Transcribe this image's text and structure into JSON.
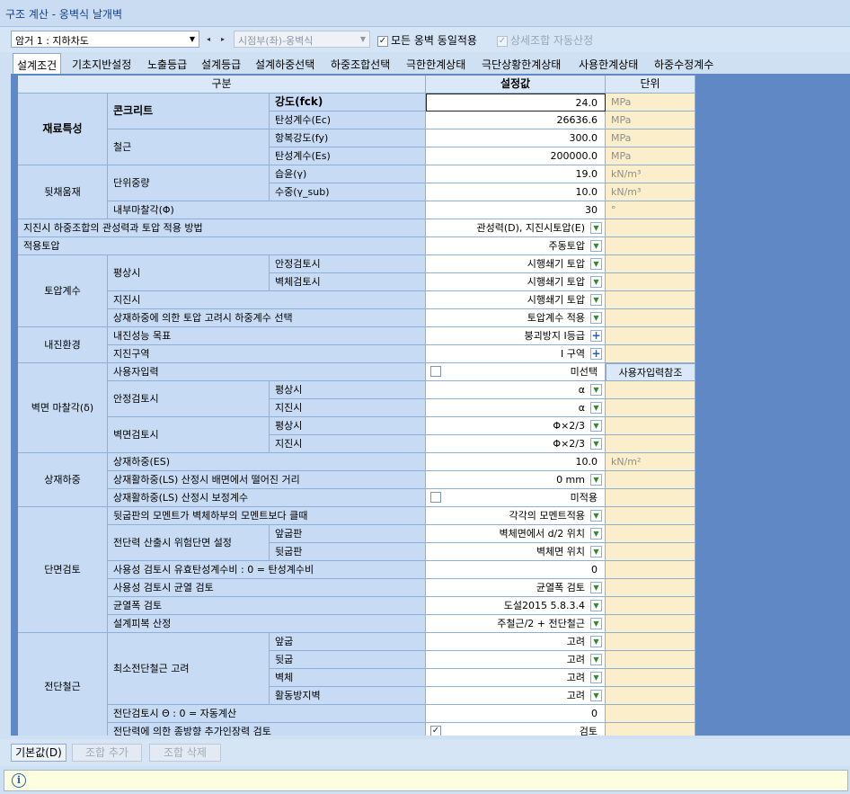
{
  "window": {
    "title": "구조 계산 - 옹벽식 날개벽"
  },
  "toolbar": {
    "section_combo": "암거 1 : 지하차도",
    "prev_icon": "◂",
    "next_icon": "▸",
    "position_combo": "시점부(좌)-옹벽식",
    "apply_all_label": "모든 옹벽 동일적용",
    "auto_combo_label": "상세조합 자동산정"
  },
  "tabs": [
    "설계조건",
    "기초지반설정",
    "노출등급",
    "설계등급",
    "설계하중선택",
    "하중조합선택",
    "극한한계상태",
    "극단상황한계상태",
    "사용한계상태",
    "하중수정계수"
  ],
  "grid": {
    "headers": {
      "category": "구분",
      "value": "설정값",
      "unit": "단위"
    },
    "material": {
      "cat": "재료특성",
      "concrete": "콘크리트",
      "rebar": "철근",
      "fck": {
        "label": "강도(fck)",
        "value": "24.0",
        "unit": "MPa"
      },
      "ec": {
        "label": "탄성계수(Ec)",
        "value": "26636.6",
        "unit": "MPa"
      },
      "fy": {
        "label": "항복강도(fy)",
        "value": "300.0",
        "unit": "MPa"
      },
      "es": {
        "label": "탄성계수(Es)",
        "value": "200000.0",
        "unit": "MPa"
      }
    },
    "backfill": {
      "cat": "뒷채움재",
      "unit_weight": "단위중량",
      "wet": {
        "label": "습윤(γ)",
        "value": "19.0",
        "unit": "kN/m³"
      },
      "sub": {
        "label": "수중(γ_sub)",
        "value": "10.0",
        "unit": "kN/m³"
      },
      "friction": {
        "label": "내부마찰각(Φ)",
        "value": "30",
        "unit": "°"
      }
    },
    "seismic_inertia": {
      "label": "지진시 하중조합의 관성력과 토압 적용 방법",
      "value": "관성력(D), 지진시토압(E)"
    },
    "applied_pressure": {
      "label": "적용토압",
      "value": "주동토압"
    },
    "pressure_coef": {
      "cat": "토압계수",
      "normal": "평상시",
      "stability": {
        "label": "안정검토시",
        "value": "시행쇄기 토압"
      },
      "wall": {
        "label": "벽체검토시",
        "value": "시행쇄기 토압"
      },
      "seismic": {
        "label": "지진시",
        "value": "시행쇄기 토압"
      },
      "surcharge": {
        "label": "상재하중에 의한 토압 고려시 하중계수 선택",
        "value": "토압계수 적용"
      }
    },
    "seismic_env": {
      "cat": "내진환경",
      "goal": {
        "label": "내진성능 목표",
        "value": "붕괴방지 I등급"
      },
      "zone": {
        "label": "지진구역",
        "value": "I 구역"
      }
    },
    "wall_friction": {
      "cat": "벽면 마찰각(δ)",
      "user": {
        "label": "사용자입력",
        "value": "미선택",
        "button": "사용자입력참조"
      },
      "stability": "안정검토시",
      "wall": "벽면검토시",
      "s_normal": {
        "label": "평상시",
        "value": "α"
      },
      "s_seismic": {
        "label": "지진시",
        "value": "α"
      },
      "w_normal": {
        "label": "평상시",
        "value": "Φ×2/3"
      },
      "w_seismic": {
        "label": "지진시",
        "value": "Φ×2/3"
      }
    },
    "surcharge": {
      "cat": "상재하중",
      "es": {
        "label": "상재하중(ES)",
        "value": "10.0",
        "unit": "kN/m²"
      },
      "ls_distance": {
        "label": "상재활하중(LS) 산정시 배면에서 떨어진 거리",
        "value": "0 mm"
      },
      "ls_factor": {
        "label": "상재활하중(LS) 산정시 보정계수",
        "value": "미적용"
      }
    },
    "section": {
      "cat": "단면검토",
      "heel_moment": {
        "label": "뒷굽판의 모멘트가 벽체하부의 모멘트보다 클때",
        "value": "각각의 모멘트적용"
      },
      "critical": "전단력 산출시 위험단면 설정",
      "toe": {
        "label": "앞굽판",
        "value": "벽체면에서 d/2 위치"
      },
      "heel": {
        "label": "뒷굽판",
        "value": "벽체면 위치"
      },
      "eff_ratio": {
        "label": "사용성 검토시 유효탄성계수비 : 0 = 탄성계수비",
        "value": "0"
      },
      "crack": {
        "label": "사용성 검토시 균열 검토",
        "value": "균열폭 검토"
      },
      "crack_width": {
        "label": "균열폭 검토",
        "value": "도설2015 5.8.3.4"
      },
      "cover": {
        "label": "설계피복 산정",
        "value": "주철근/2 + 전단철근"
      }
    },
    "shear": {
      "cat": "전단철근",
      "min": "최소전단철근 고려",
      "toe": {
        "label": "앞굽",
        "value": "고려"
      },
      "heel": {
        "label": "뒷굽",
        "value": "고려"
      },
      "wall": {
        "label": "벽체",
        "value": "고려"
      },
      "shear_key": {
        "label": "활동방지벽",
        "value": "고려"
      },
      "theta": {
        "label": "전단검토시 Θ : 0 = 자동계산",
        "value": "0"
      },
      "longitudinal": {
        "label": "전단력에 의한 종방향 추가인장력 검토",
        "value": "검토"
      }
    }
  },
  "bottom": {
    "default_btn": "기본값(D)",
    "add_btn": "조합 추가",
    "del_btn": "조합 삭제"
  },
  "status": {
    "info_icon": "i"
  }
}
